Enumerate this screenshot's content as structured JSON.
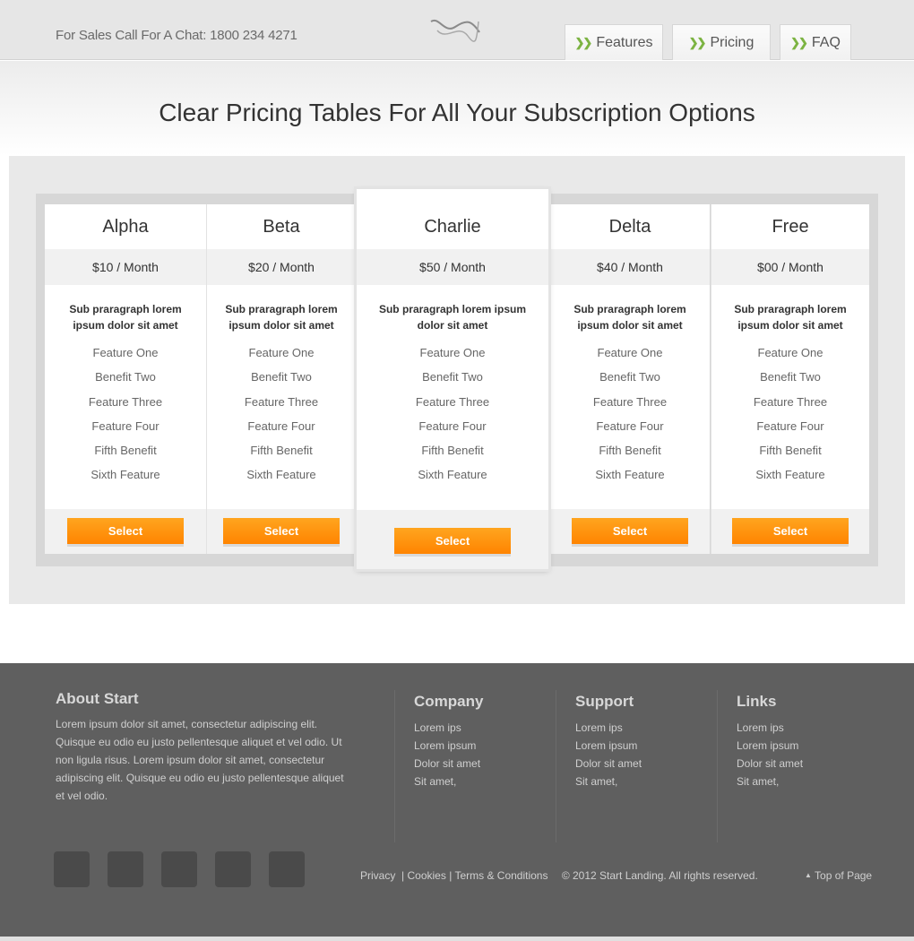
{
  "header": {
    "sales_text": "For Sales Call For A Chat: 1800 234 4271",
    "nav": [
      {
        "label": "Features"
      },
      {
        "label": "Pricing"
      },
      {
        "label": "FAQ"
      }
    ]
  },
  "headline": "Clear Pricing Tables For All Your Subscription Options",
  "plans": [
    {
      "name": "Alpha",
      "price": "$10 / Month",
      "sub": "Sub praragraph lorem ipsum dolor sit amet",
      "features": [
        "Feature One",
        "Benefit Two",
        "Feature Three",
        "Feature Four",
        "Fifth Benefit",
        "Sixth Feature"
      ],
      "button": "Select"
    },
    {
      "name": "Beta",
      "price": "$20 / Month",
      "sub": "Sub praragraph lorem ipsum dolor sit amet",
      "features": [
        "Feature One",
        "Benefit Two",
        "Feature Three",
        "Feature Four",
        "Fifth Benefit",
        "Sixth Feature"
      ],
      "button": "Select"
    },
    {
      "name": "Charlie",
      "price": "$50 / Month",
      "sub": "Sub praragraph lorem ipsum dolor sit amet",
      "features": [
        "Feature One",
        "Benefit Two",
        "Feature Three",
        "Feature Four",
        "Fifth Benefit",
        "Sixth Feature"
      ],
      "button": "Select"
    },
    {
      "name": "Delta",
      "price": "$40 / Month",
      "sub": "Sub praragraph lorem ipsum dolor sit amet",
      "features": [
        "Feature One",
        "Benefit Two",
        "Feature Three",
        "Feature Four",
        "Fifth Benefit",
        "Sixth Feature"
      ],
      "button": "Select"
    },
    {
      "name": "Free",
      "price": "$00 / Month",
      "sub": "Sub praragraph lorem ipsum dolor sit amet",
      "features": [
        "Feature One",
        "Benefit Two",
        "Feature Three",
        "Feature Four",
        "Fifth Benefit",
        "Sixth Feature"
      ],
      "button": "Select"
    }
  ],
  "footer": {
    "about_title": "About Start",
    "about_text": "Lorem ipsum dolor sit amet, consectetur adipiscing elit. Quisque eu odio eu justo pellentesque aliquet et vel odio. Ut non ligula risus.  Lorem ipsum dolor sit amet, consectetur adipiscing elit. Quisque eu odio eu justo pellentesque aliquet et vel odio.",
    "columns": [
      {
        "title": "Company",
        "links": [
          "Lorem ips",
          "Lorem ipsum",
          "Dolor sit amet",
          "Sit amet,"
        ]
      },
      {
        "title": "Support",
        "links": [
          "Lorem ips",
          "Lorem ipsum",
          "Dolor sit amet",
          "Sit amet,"
        ]
      },
      {
        "title": "Links",
        "links": [
          "Lorem ips",
          "Lorem ipsum",
          "Dolor sit amet",
          "Sit amet,"
        ]
      }
    ],
    "legal": {
      "privacy": "Privacy",
      "cookies": "Cookies",
      "terms": "Terms & Conditions",
      "copyright": "© 2012 Start Landing. All rights reserved."
    },
    "top_link": "Top of Page"
  },
  "colors": {
    "accent_orange": "#ff8c00",
    "nav_chevron": "#7cb342",
    "footer_bg": "#5f5f5f"
  },
  "icons": {
    "logo": "wave-logo-icon",
    "nav_chevron": "double-chevron-right-icon",
    "top_caret": "caret-up-icon"
  }
}
